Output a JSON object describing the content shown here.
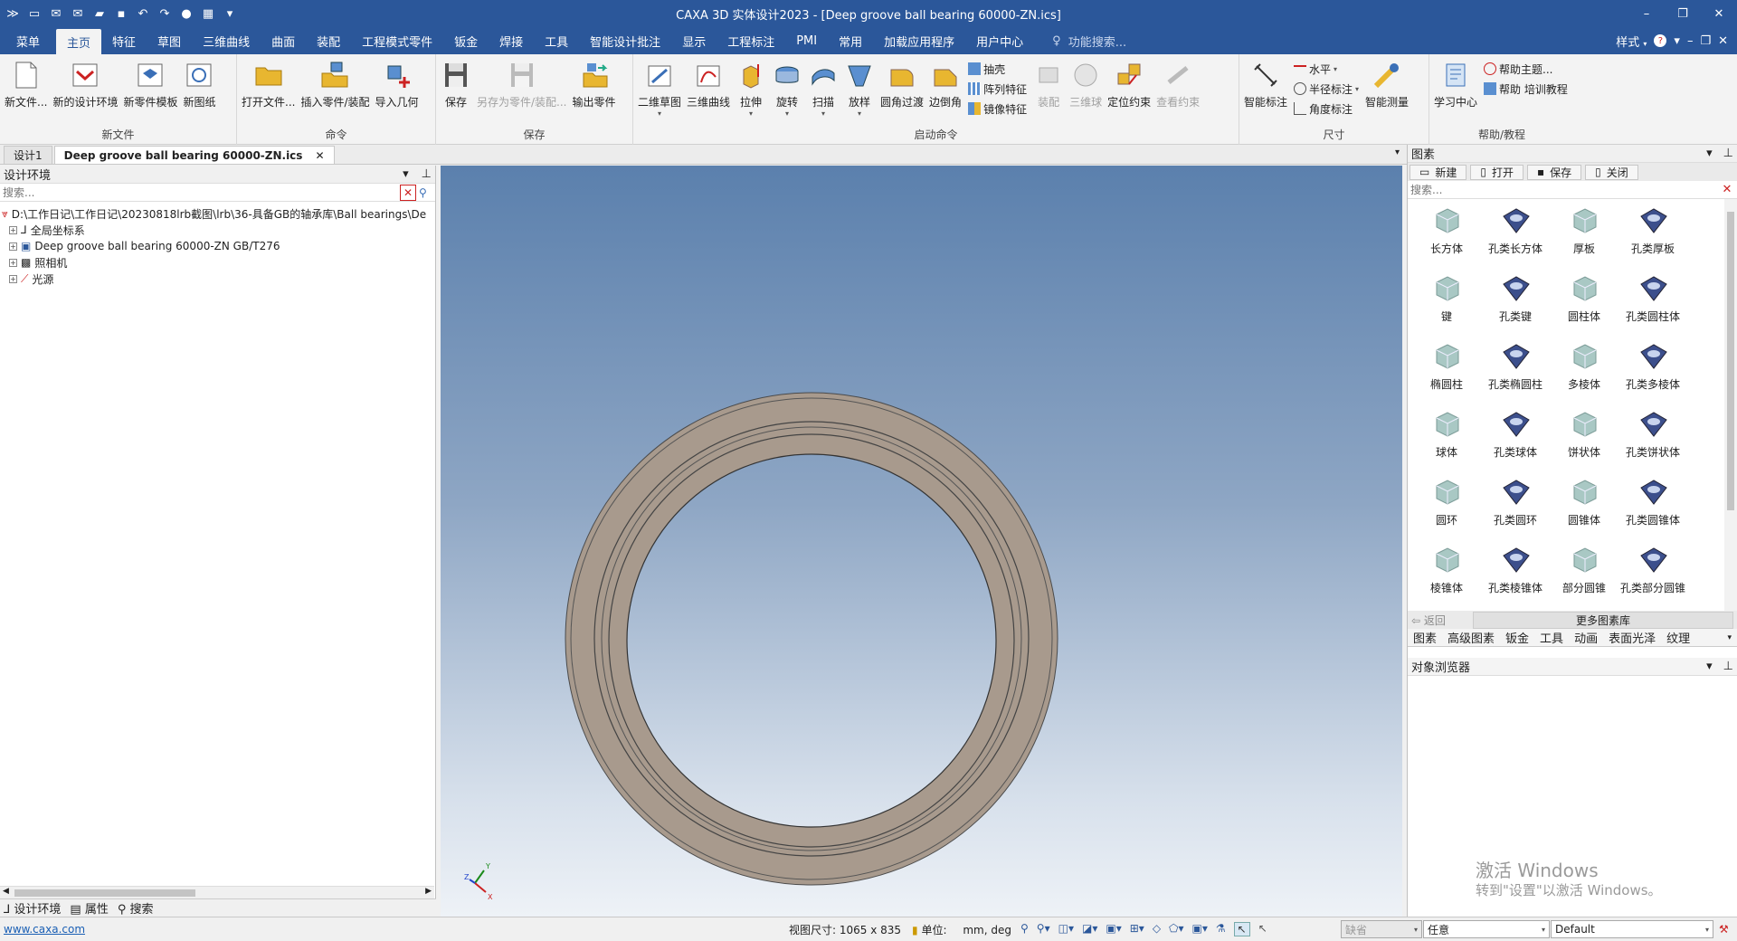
{
  "window": {
    "title": "CAXA 3D 实体设计2023 - [Deep groove ball bearing 60000-ZN.ics]"
  },
  "menu": {
    "tabs": [
      "菜单",
      "主页",
      "特征",
      "草图",
      "三维曲线",
      "曲面",
      "装配",
      "工程模式零件",
      "钣金",
      "焊接",
      "工具",
      "智能设计批注",
      "显示",
      "工程标注",
      "PMI",
      "常用",
      "加载应用程序",
      "用户中心"
    ],
    "active": "主页",
    "feature_search": "功能搜索...",
    "style_label": "样式"
  },
  "ribbon": {
    "groups": {
      "newfile": "新文件",
      "command": "命令",
      "save": "保存",
      "launch": "启动命令",
      "dimension": "尺寸",
      "help": "帮助/教程"
    },
    "newfile": [
      "新文件...",
      "新的设计环境",
      "新零件模板",
      "新图纸"
    ],
    "command": [
      "打开文件...",
      "插入零件/装配",
      "导入几何"
    ],
    "save": [
      "保存",
      "另存为零件/装配...",
      "输出零件"
    ],
    "launch": [
      "二维草图",
      "三维曲线",
      "拉伸",
      "旋转",
      "扫描",
      "放样",
      "圆角过渡",
      "边倒角"
    ],
    "launch_small": [
      "抽壳",
      "阵列特征",
      "镜像特征"
    ],
    "launch2": [
      "装配",
      "三维球",
      "定位约束",
      "查看约束"
    ],
    "dim": [
      "智能标注",
      "智能测量"
    ],
    "dim_small": [
      "水平",
      "半径标注",
      "角度标注"
    ],
    "help": [
      "学习中心"
    ],
    "help_small": [
      "帮助主题...",
      "帮助 培训教程"
    ]
  },
  "doctabs": [
    "设计1",
    "Deep groove ball bearing 60000-ZN.ics"
  ],
  "leftpanel": {
    "title": "设计环境",
    "search_placeholder": "搜索...",
    "tree": [
      "D:\\工作日记\\工作日记\\20230818lrb截图\\lrb\\36-具备GB的轴承库\\Ball bearings\\De",
      "全局坐标系",
      "Deep groove ball bearing 60000-ZN GB/T276",
      "照相机",
      "光源"
    ],
    "bottom_tabs": [
      "设计环境",
      "属性",
      "搜索"
    ]
  },
  "library": {
    "title": "图素",
    "toolbar": [
      "新建",
      "打开",
      "保存",
      "关闭"
    ],
    "search_placeholder": "搜索...",
    "items": [
      "长方体",
      "孔类长方体",
      "厚板",
      "孔类厚板",
      "键",
      "孔类键",
      "圆柱体",
      "孔类圆柱体",
      "椭圆柱",
      "孔类椭圆柱",
      "多棱体",
      "孔类多棱体",
      "球体",
      "孔类球体",
      "饼状体",
      "孔类饼状体",
      "圆环",
      "孔类圆环",
      "圆锥体",
      "孔类圆锥体",
      "棱锥体",
      "孔类棱锥体",
      "部分圆锥",
      "孔类部分圆锥"
    ],
    "back": "返回",
    "more": "更多图素库",
    "tabs": [
      "图素",
      "高级图素",
      "钣金",
      "工具",
      "动画",
      "表面光泽",
      "纹理"
    ]
  },
  "objbrowser": {
    "title": "对象浏览器"
  },
  "watermark": {
    "line1": "激活 Windows",
    "line2": "转到\"设置\"以激活 Windows。"
  },
  "status": {
    "link": "www.caxa.com",
    "viewsize": "视图尺寸: 1065 x  835",
    "unit_label": "单位:",
    "unit_value": "mm, deg",
    "field1": "缺省",
    "field2": "任意",
    "field3": "Default"
  },
  "colors": {
    "titlebar": "#2b579a",
    "ring": "#a89a8d"
  }
}
